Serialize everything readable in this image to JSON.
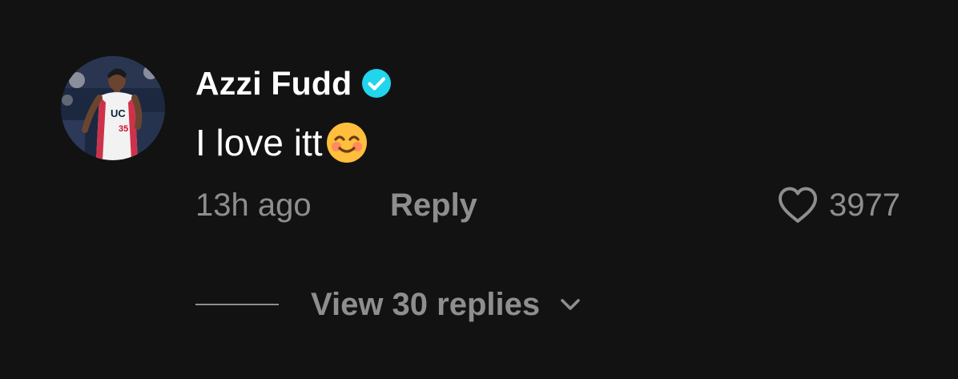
{
  "comment": {
    "username": "Azzi Fudd",
    "verified": true,
    "avatar": "player-photo",
    "text": "I love itt",
    "emoji": "smiling-face-with-smiling-eyes",
    "timestamp": "13h ago",
    "reply_label": "Reply",
    "like_count": "3977",
    "view_replies_label": "View 30 replies"
  },
  "icons": {
    "verified": "verified-badge-icon",
    "like": "heart-outline-icon",
    "expand": "chevron-down-icon"
  },
  "colors": {
    "background": "#121212",
    "primary_text": "#ffffff",
    "secondary_text": "#8e8e8e",
    "verified_badge": "#20d5ec",
    "emoji": "#ffbe3c"
  }
}
